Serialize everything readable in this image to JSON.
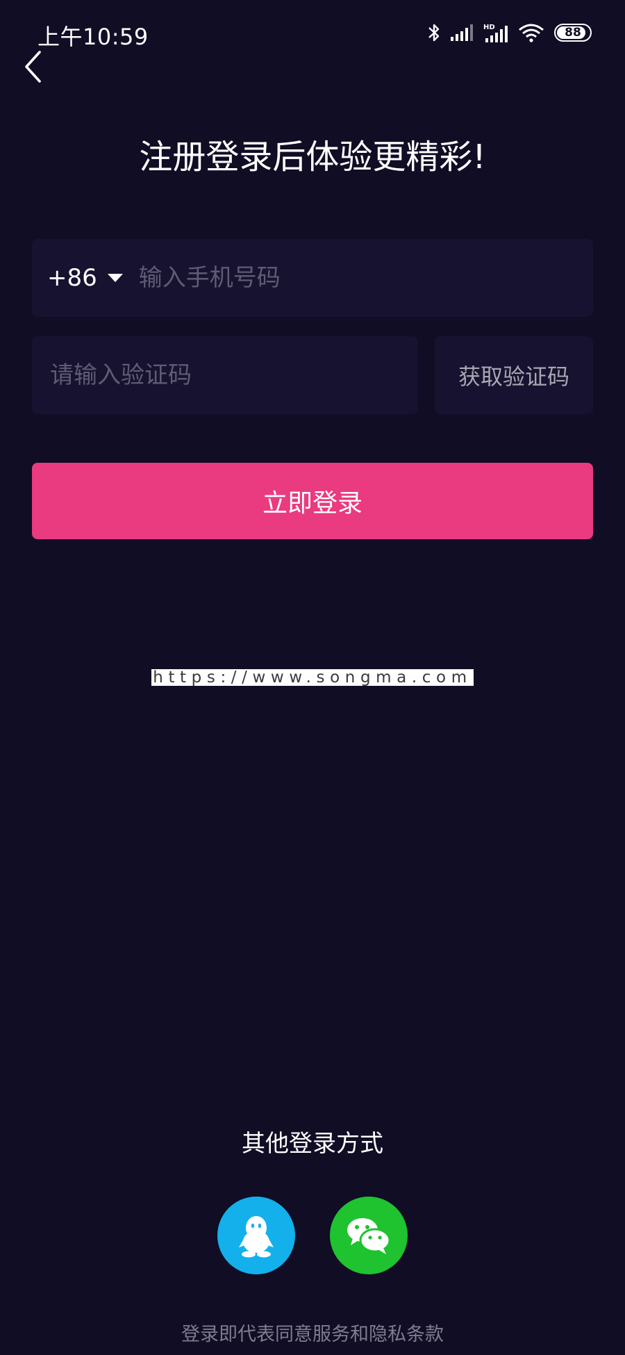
{
  "status_bar": {
    "time": "上午10:59",
    "network_label": "HD",
    "battery": "88",
    "icons": [
      "bluetooth-icon",
      "signal-icon",
      "hd-signal-icon",
      "wifi-icon",
      "battery-icon"
    ]
  },
  "header": {
    "title": "注册登录后体验更精彩!"
  },
  "form": {
    "country_code": "+86",
    "phone_placeholder": "输入手机号码",
    "phone_value": "",
    "code_placeholder": "请输入验证码",
    "code_value": "",
    "get_code_label": "获取验证码",
    "login_label": "立即登录"
  },
  "watermark": "https://www.songma.com",
  "other_login": {
    "label": "其他登录方式",
    "providers": [
      {
        "icon": "qq-icon",
        "color": "#13b0ec"
      },
      {
        "icon": "wechat-icon",
        "color": "#1fc22f"
      }
    ]
  },
  "footer": {
    "terms": "登录即代表同意服务和隐私条款"
  },
  "colors": {
    "background": "#100d25",
    "input_background": "#17122f",
    "accent": "#ea3a80",
    "placeholder": "#5e5b73"
  }
}
